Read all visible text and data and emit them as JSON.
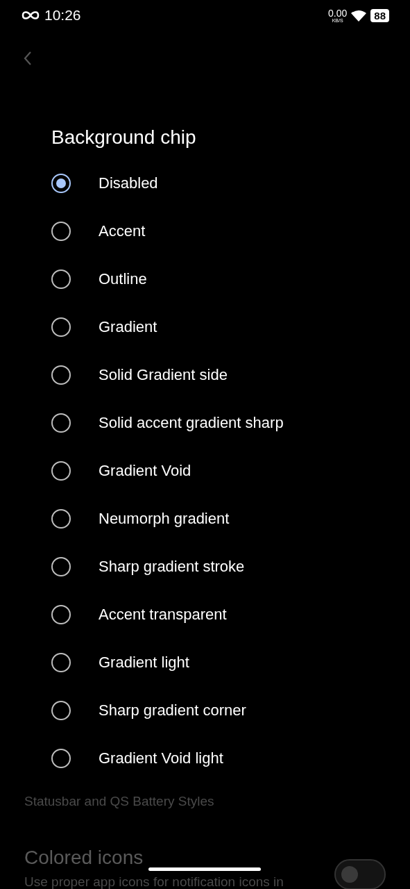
{
  "status_bar": {
    "time": "10:26",
    "net_speed": "0.00",
    "net_unit": "KB/S",
    "battery": "88"
  },
  "background_settings": [
    {
      "kind": "subtitle",
      "summary": "Statusbar and QS Battery Styles"
    },
    {
      "kind": "switch",
      "title": "Colored icons",
      "summary": "Use proper app icons for notification icons in",
      "on": false
    }
  ],
  "dialog": {
    "title": "Background chip",
    "options": [
      {
        "label": "Disabled",
        "selected": true
      },
      {
        "label": "Accent",
        "selected": false
      },
      {
        "label": "Outline",
        "selected": false
      },
      {
        "label": "Gradient",
        "selected": false
      },
      {
        "label": "Solid Gradient side",
        "selected": false
      },
      {
        "label": "Solid accent gradient sharp",
        "selected": false
      },
      {
        "label": "Gradient Void",
        "selected": false
      },
      {
        "label": "Neumorph gradient",
        "selected": false
      },
      {
        "label": "Sharp gradient stroke",
        "selected": false
      },
      {
        "label": "Accent transparent",
        "selected": false
      },
      {
        "label": "Gradient light",
        "selected": false
      },
      {
        "label": "Sharp gradient corner",
        "selected": false
      },
      {
        "label": "Gradient Void light",
        "selected": false
      }
    ]
  }
}
